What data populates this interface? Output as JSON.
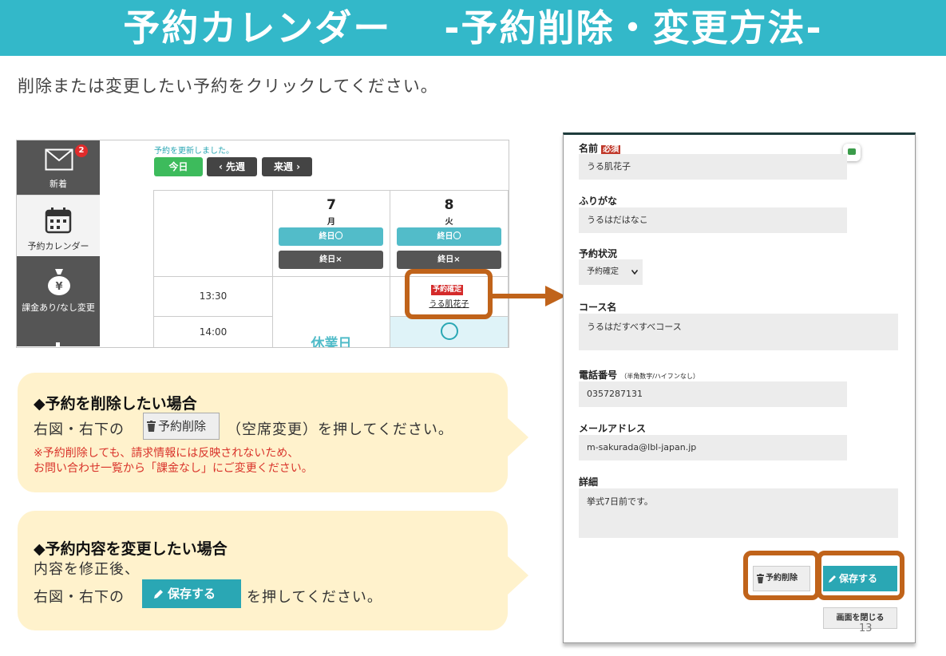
{
  "header": {
    "title": "予約カレンダー　 -予約削除・変更方法-"
  },
  "instruction": "削除または変更したい予約をクリックしてください。",
  "calendar": {
    "sidebar": {
      "new_label": "新着",
      "badge": "2",
      "calendar_label": "予約カレンダー",
      "billing_label": "課金あり/なし変更"
    },
    "notice": "予約を更新しました。",
    "buttons": {
      "today": "今日",
      "prev": "‹ 先週",
      "next": "来週 ›"
    },
    "days": [
      {
        "date": "7",
        "weekday": "月",
        "allday_on": "終日〇",
        "allday_off": "終日×"
      },
      {
        "date": "8",
        "weekday": "火",
        "allday_on": "終日〇",
        "allday_off": "終日×"
      }
    ],
    "times": [
      "13:30",
      "14:00"
    ],
    "closed_label": "休業日",
    "booking": {
      "status": "予約確定",
      "name": "うる肌花子"
    },
    "open_mark": "〇"
  },
  "callout_delete": {
    "title": "◆予約を削除したい場合",
    "text_before": "右図・右下の",
    "button_label": "予約削除",
    "text_after": "（空席変更）を押してください。",
    "note_line1": "※予約削除しても、請求情報には反映されないため、",
    "note_line2": "お問い合わせ一覧から「課金なし」にご変更ください。"
  },
  "callout_edit": {
    "title": "◆予約内容を変更したい場合",
    "line1": "内容を修正後、",
    "text_before": "右図・右下の",
    "button_label": "保存する",
    "text_after": "を押してください。"
  },
  "form": {
    "name_label": "名前",
    "required_badge": "必須",
    "name_value": "うる肌花子",
    "kana_label": "ふりがな",
    "kana_value": "うるはだはなこ",
    "status_label": "予約状況",
    "status_value": "予約確定",
    "course_label": "コース名",
    "course_value": "うるはだすべすべコース",
    "phone_label": "電話番号",
    "phone_hint": "（半角数字/ハイフンなし）",
    "phone_value": "0357287131",
    "email_label": "メールアドレス",
    "email_value": "m-sakurada@lbl-japan.jp",
    "detail_label": "詳細",
    "detail_value": "挙式7日前です。",
    "delete_label": "予約削除",
    "save_label": "保存する",
    "close_label": "画面を閉じる"
  },
  "page_number": "13",
  "colors": {
    "header": "#33b8c9",
    "accent": "#c0631a",
    "teal_button": "#2aa7b4",
    "today_green": "#3dbb5c",
    "callout_bg": "#fff2cc"
  }
}
